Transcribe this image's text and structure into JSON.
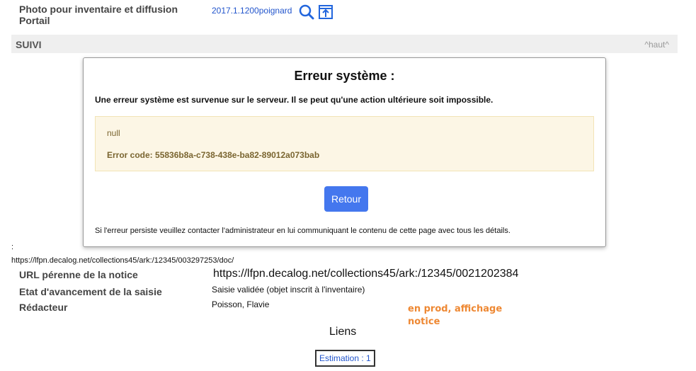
{
  "top": {
    "photo_label": "Photo pour inventaire et diffusion Portail",
    "photo_link": "2017.1.1200poignard"
  },
  "suivi": {
    "title": "SUIVI",
    "haut": "^haut^"
  },
  "modal": {
    "title": "Erreur système :",
    "message": "Une erreur système est survenue sur le serveur. Il se peut qu'une action ultérieure soit impossible.",
    "null_text": "null",
    "error_code": "Error code: 55836b8a-c738-438e-ba82-89012a073bab",
    "retour_label": "Retour",
    "footer": "Si l'erreur persiste veuillez contacter l'administrateur en lui communiquant le contenu de cette page avec tous les détails."
  },
  "below": {
    "colon": ":",
    "doc_url": "https://lfpn.decalog.net/collections45/ark:/12345/003297253/doc/"
  },
  "fields": {
    "url_label": "URL pérenne de la notice",
    "url_value": "https://lfpn.decalog.net/collections45/ark:/12345/0021202384",
    "etat_label": "Etat d'avancement de la saisie",
    "etat_value": "Saisie validée (objet inscrit à l'inventaire)",
    "redacteur_label": "Rédacteur",
    "redacteur_value": "Poisson, Flavie"
  },
  "note": "en prod, affichage notice",
  "liens": {
    "title": "Liens",
    "estimation": "Estimation : 1"
  },
  "colors": {
    "accent": "#4477ee",
    "link": "#2255cc",
    "note": "#ee8833"
  }
}
